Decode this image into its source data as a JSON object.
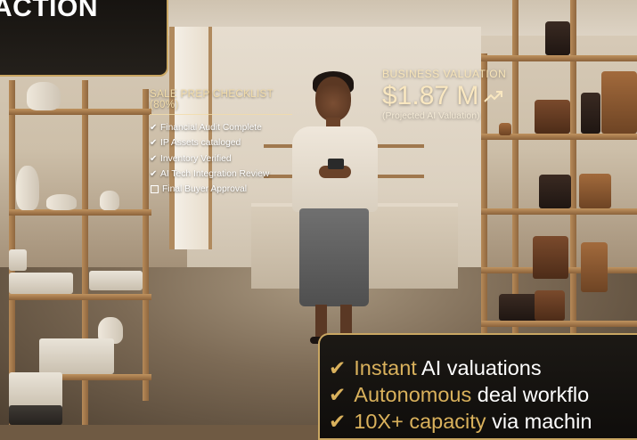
{
  "banner": {
    "title": "ACTION"
  },
  "checklist": {
    "heading": "SALE PREP CHECKLIST (80%)",
    "progress_percent": 80,
    "items": [
      {
        "label": "Financial Audit Complete",
        "done": true
      },
      {
        "label": "IP Assets cataloged",
        "done": true
      },
      {
        "label": "Inventory Verified",
        "done": true
      },
      {
        "label": "AI Tech Integration Review",
        "done": true
      },
      {
        "label": "Final Buyer Approval",
        "done": false
      }
    ],
    "icons": {
      "done": "checkmark-icon",
      "pending": "checkbox-empty-icon"
    }
  },
  "valuation": {
    "label": "BUSINESS VALUATION",
    "amount": "$1.87 M",
    "trend_icon": "trend-up-icon",
    "note": "(Projected AI Valuation)"
  },
  "features": {
    "items": [
      {
        "highlight": "Instant",
        "rest": " AI valuations"
      },
      {
        "highlight": "Autonomous",
        "rest": " deal workflo"
      },
      {
        "highlight": "10X+ capacity",
        "rest": " via machin"
      }
    ],
    "icon": "heavy-checkmark-icon"
  },
  "colors": {
    "accent_gold": "#d9b15c",
    "panel_dark": "#15120f",
    "border_gold": "#c9a662"
  }
}
